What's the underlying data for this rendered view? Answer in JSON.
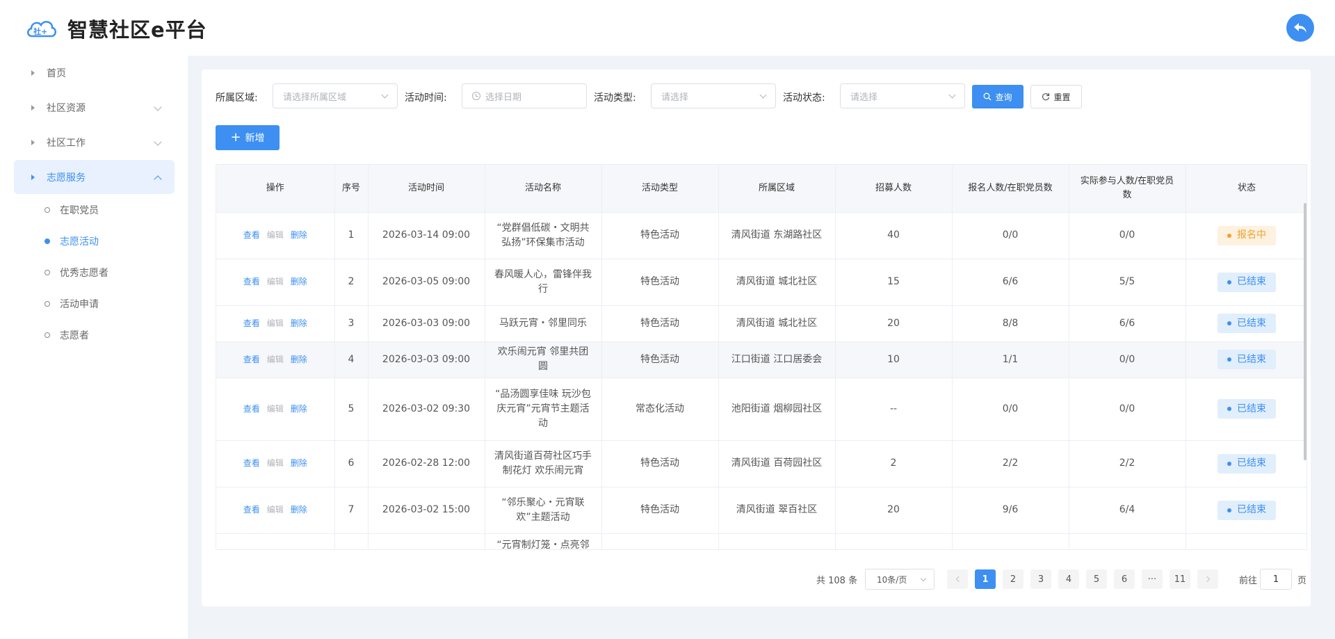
{
  "app": {
    "title": "智慧社区e平台",
    "logo_text": "社+"
  },
  "sidebar": {
    "items": [
      {
        "label": "首页"
      },
      {
        "label": "社区资源"
      },
      {
        "label": "社区工作"
      },
      {
        "label": "志愿服务"
      }
    ],
    "sub_items": [
      {
        "label": "在职党员"
      },
      {
        "label": "志愿活动"
      },
      {
        "label": "优秀志愿者"
      },
      {
        "label": "活动申请"
      },
      {
        "label": "志愿者"
      }
    ]
  },
  "filters": {
    "area_label": "所属区域:",
    "area_placeholder": "请选择所属区域",
    "time_label": "活动时间:",
    "time_placeholder": "选择日期",
    "type_label": "活动类型:",
    "type_placeholder": "请选择",
    "status_label": "活动状态:",
    "status_placeholder": "请选择",
    "search_label": "查询",
    "reset_label": "重置"
  },
  "toolbar": {
    "add_label": "新增"
  },
  "table": {
    "headers": [
      "操作",
      "序号",
      "活动时间",
      "活动名称",
      "活动类型",
      "所属区域",
      "招募人数",
      "报名人数/在职党员数",
      "实际参与人数/在职党员数",
      "状态"
    ],
    "actions": {
      "view": "查看",
      "edit": "编辑",
      "delete": "删除"
    },
    "rows": [
      {
        "no": "1",
        "time": "2026-03-14 09:00",
        "name": "“党群倡低碳・文明共弘扬”环保集市活动",
        "type": "特色活动",
        "area": "清风街道 东湖路社区",
        "recruit": "40",
        "signup": "0/0",
        "actual": "0/0",
        "status": "报名中",
        "status_kind": "signup"
      },
      {
        "no": "2",
        "time": "2026-03-05 09:00",
        "name": "春风暖人心，雷锋伴我行",
        "type": "特色活动",
        "area": "清风街道 城北社区",
        "recruit": "15",
        "signup": "6/6",
        "actual": "5/5",
        "status": "已结束",
        "status_kind": "ended"
      },
      {
        "no": "3",
        "time": "2026-03-03 09:00",
        "name": "马跃元宵・邻里同乐",
        "type": "特色活动",
        "area": "清风街道 城北社区",
        "recruit": "20",
        "signup": "8/8",
        "actual": "6/6",
        "status": "已结束",
        "status_kind": "ended"
      },
      {
        "no": "4",
        "time": "2026-03-03 09:00",
        "name": "欢乐闹元宵 邻里共团圆",
        "type": "特色活动",
        "area": "江口街道 江口居委会",
        "recruit": "10",
        "signup": "1/1",
        "actual": "0/0",
        "status": "已结束",
        "status_kind": "ended"
      },
      {
        "no": "5",
        "time": "2026-03-02 09:30",
        "name": "“品汤圆享佳味 玩沙包庆元宵”元宵节主题活动",
        "type": "常态化活动",
        "area": "池阳街道 烟柳园社区",
        "recruit": "--",
        "signup": "0/0",
        "actual": "0/0",
        "status": "已结束",
        "status_kind": "ended"
      },
      {
        "no": "6",
        "time": "2026-02-28 12:00",
        "name": "清风街道百荷社区巧手制花灯 欢乐闹元宵",
        "type": "特色活动",
        "area": "清风街道 百荷园社区",
        "recruit": "2",
        "signup": "2/2",
        "actual": "2/2",
        "status": "已结束",
        "status_kind": "ended"
      },
      {
        "no": "7",
        "time": "2026-03-02 15:00",
        "name": "“邻乐聚心・元宵联欢”主题活动",
        "type": "特色活动",
        "area": "清风街道 翠百社区",
        "recruit": "20",
        "signup": "9/6",
        "actual": "6/4",
        "status": "已结束",
        "status_kind": "ended"
      },
      {
        "no": "",
        "time": "",
        "name": "“元宵制灯笼・点亮邻",
        "type": "",
        "area": "",
        "recruit": "",
        "signup": "",
        "actual": "",
        "status": "",
        "status_kind": "partial"
      }
    ]
  },
  "pagination": {
    "total": "共 108 条",
    "page_size": "10条/页",
    "pages": [
      "1",
      "2",
      "3",
      "4",
      "5",
      "6",
      "···",
      "11"
    ],
    "current": "1",
    "goto_label": "前往",
    "goto_value": "1",
    "goto_unit": "页"
  },
  "colors": {
    "primary": "#3d8ff2",
    "signup": "#f0a12b",
    "background": "#f0f4f9"
  }
}
